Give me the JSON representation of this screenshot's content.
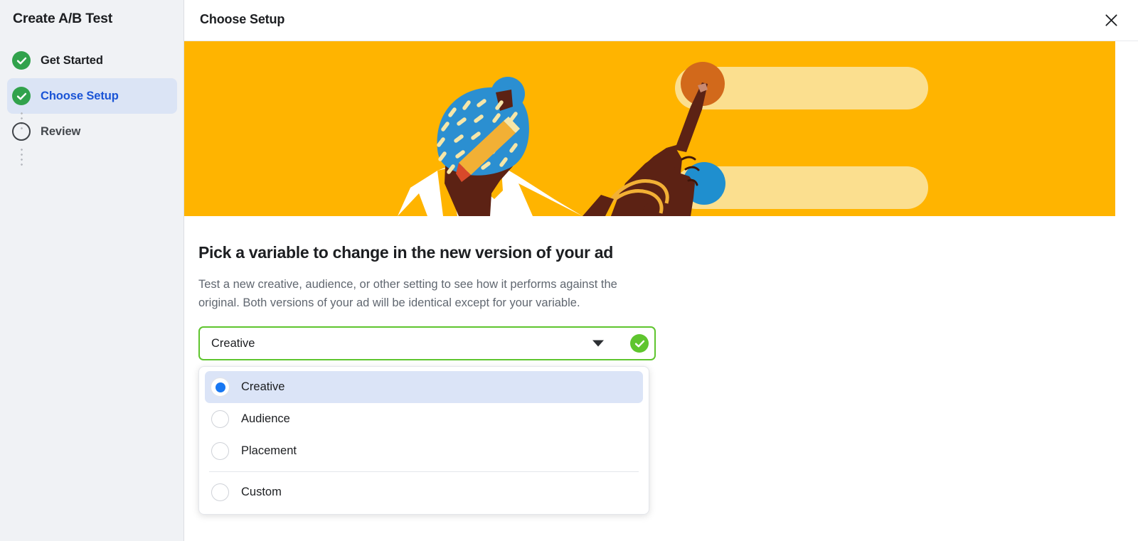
{
  "sidebar": {
    "title": "Create A/B Test",
    "items": [
      {
        "label": "Get Started",
        "state": "done"
      },
      {
        "label": "Choose Setup",
        "state": "active"
      },
      {
        "label": "Review",
        "state": "todo"
      }
    ]
  },
  "header": {
    "title": "Choose Setup",
    "close_icon": "close-icon"
  },
  "banner": {
    "colors": {
      "background": "#ffb400",
      "bar": "#fbdf8f",
      "headwrap": "#2b8fd1",
      "dash": "#f6e6a8",
      "skin": "#5c2214",
      "skin_light": "#7a3218",
      "shirt": "#ffffff",
      "pencil": "#f2b035",
      "pencil_tip": "#d8492a",
      "circle_orange": "#d2691b",
      "circle_blue": "#1f8fcf",
      "bangle": "#f2b035"
    }
  },
  "main": {
    "heading": "Pick a variable to change in the new version of your ad",
    "description": "Test a new creative, audience, or other setting to see how it performs against the original. Both versions of your ad will be identical except for your variable.",
    "select": {
      "value": "Creative",
      "valid": true,
      "caret_icon": "chevron-down-icon",
      "valid_icon": "check-circle-icon",
      "options": [
        {
          "label": "Creative",
          "selected": true,
          "divider_after": false
        },
        {
          "label": "Audience",
          "selected": false,
          "divider_after": false
        },
        {
          "label": "Placement",
          "selected": false,
          "divider_after": true
        },
        {
          "label": "Custom",
          "selected": false,
          "divider_after": false
        }
      ]
    }
  },
  "colors": {
    "accent_blue": "#1a54d6",
    "success_green": "#31a24c",
    "valid_green": "#5fc52e",
    "radio_blue": "#1877f2",
    "highlight": "#dbe4f5"
  }
}
